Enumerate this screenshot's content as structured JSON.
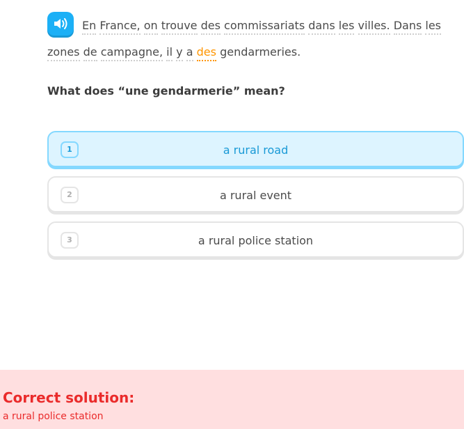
{
  "passage": {
    "words_line1": [
      "En",
      "France,",
      "on",
      "trouve",
      "des",
      "commissariats",
      "dans",
      "les",
      "villes.",
      "Dans",
      "les"
    ],
    "words_line2": [
      "zones",
      "de",
      "campagne,",
      "il",
      "y",
      "a",
      "des",
      "gendarmeries."
    ],
    "highlight_color": "#ff9600"
  },
  "speaker": {
    "icon": "speaker-icon",
    "color": "#1cb0f6"
  },
  "question": "What does “une gendarmerie” mean?",
  "options": [
    {
      "number": "1",
      "text": "a rural road",
      "selected": true
    },
    {
      "number": "2",
      "text": "a rural event",
      "selected": false
    },
    {
      "number": "3",
      "text": "a rural police station",
      "selected": false
    }
  ],
  "feedback": {
    "title": "Correct solution:",
    "answer": "a rural police station",
    "color": "#ea2b2b",
    "background": "#ffdfe0"
  }
}
